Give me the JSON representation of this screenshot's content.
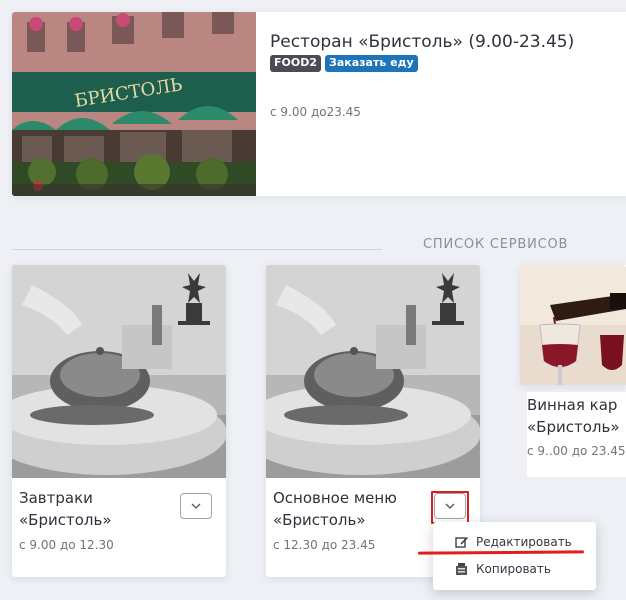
{
  "restaurant": {
    "title": "Ресторан «Бристоль» (9.00-23.45)",
    "badge_code": "FOOD2",
    "badge_order": "Заказать еду",
    "hours": "с 9.00 до23.45",
    "sign_text": "БРИСТОЛЬ"
  },
  "section": {
    "title": "СПИСОК СЕРВИСОВ"
  },
  "services": [
    {
      "name": "Завтраки «Бристоль»",
      "hours": "с 9.00 до 12.30"
    },
    {
      "name": "Основное меню «Бристоль»",
      "hours": "с 12.30 до 23.45"
    },
    {
      "name": "Винная кар «Бристоль»",
      "hours": "с 9..00 до 23.45"
    }
  ],
  "dropdown": {
    "edit": "Редактировать",
    "copy": "Копировать"
  },
  "colors": {
    "accent_blue": "#1d74b9",
    "highlight_red": "#d32020",
    "badge_gray": "#4a4d55"
  }
}
